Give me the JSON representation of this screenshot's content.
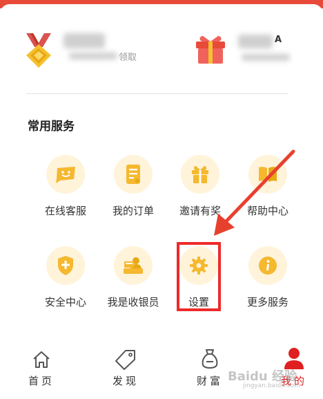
{
  "rewards": {
    "left_text": "领取",
    "right_text": "A"
  },
  "section_title": "常用服务",
  "services": [
    {
      "label": "在线客服",
      "icon": "chat-icon"
    },
    {
      "label": "我的订单",
      "icon": "order-icon"
    },
    {
      "label": "邀请有奖",
      "icon": "gift-icon"
    },
    {
      "label": "帮助中心",
      "icon": "book-icon"
    },
    {
      "label": "安全中心",
      "icon": "shield-plus-icon"
    },
    {
      "label": "我是收银员",
      "icon": "cashier-icon"
    },
    {
      "label": "设置",
      "icon": "gear-icon"
    },
    {
      "label": "更多服务",
      "icon": "info-icon"
    }
  ],
  "tabs": [
    {
      "label": "首页",
      "icon": "home-icon",
      "active": false
    },
    {
      "label": "发现",
      "icon": "tag-icon",
      "active": false
    },
    {
      "label": "财富",
      "icon": "money-bag-icon",
      "active": false
    },
    {
      "label": "我的",
      "icon": "person-icon",
      "active": true
    }
  ],
  "watermark": {
    "text": "Baidu 经验",
    "sub": "jingyan.baidu.com"
  },
  "colors": {
    "accent": "#e02020",
    "icon_orange": "#f5b82e",
    "icon_bg": "#fff3da",
    "highlight": "#ee2a2a"
  }
}
